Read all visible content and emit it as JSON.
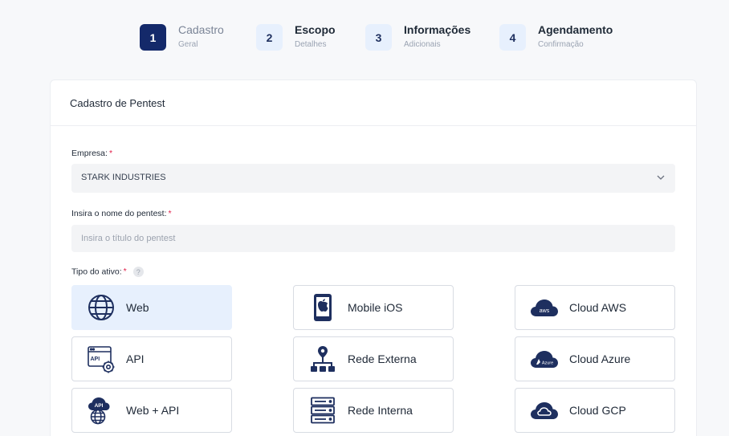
{
  "stepper": {
    "steps": [
      {
        "number": "1",
        "title": "Cadastro",
        "subtitle": "Geral",
        "active": true
      },
      {
        "number": "2",
        "title": "Escopo",
        "subtitle": "Detalhes",
        "active": false
      },
      {
        "number": "3",
        "title": "Informações",
        "subtitle": "Adicionais",
        "active": false
      },
      {
        "number": "4",
        "title": "Agendamento",
        "subtitle": "Confirmação",
        "active": false
      }
    ]
  },
  "form": {
    "title": "Cadastro de Pentest",
    "company": {
      "label": "Empresa:",
      "required": "*",
      "value": "STARK INDUSTRIES",
      "icon": "chevron-down-icon"
    },
    "pentest_name": {
      "label": "Insira o nome do pentest:",
      "required": "*",
      "placeholder": "Insira o título do pentest",
      "value": ""
    },
    "asset_type": {
      "label": "Tipo do ativo:",
      "required": "*",
      "help": "?",
      "selected": "Web",
      "options": [
        {
          "label": "Web",
          "icon": "globe-icon"
        },
        {
          "label": "Mobile iOS",
          "icon": "apple-phone-icon"
        },
        {
          "label": "Cloud AWS",
          "icon": "aws-cloud-icon"
        },
        {
          "label": "API",
          "icon": "api-gear-icon"
        },
        {
          "label": "Rede Externa",
          "icon": "network-tree-icon"
        },
        {
          "label": "Cloud Azure",
          "icon": "azure-cloud-icon"
        },
        {
          "label": "Web + API",
          "icon": "web-api-icon"
        },
        {
          "label": "Rede Interna",
          "icon": "server-rack-icon"
        },
        {
          "label": "Cloud GCP",
          "icon": "gcp-cloud-icon"
        }
      ]
    }
  },
  "colors": {
    "primary": "#14296a",
    "accent_light": "#e7f0fd",
    "required": "#e11d48",
    "icon": "#1e2f5f"
  }
}
